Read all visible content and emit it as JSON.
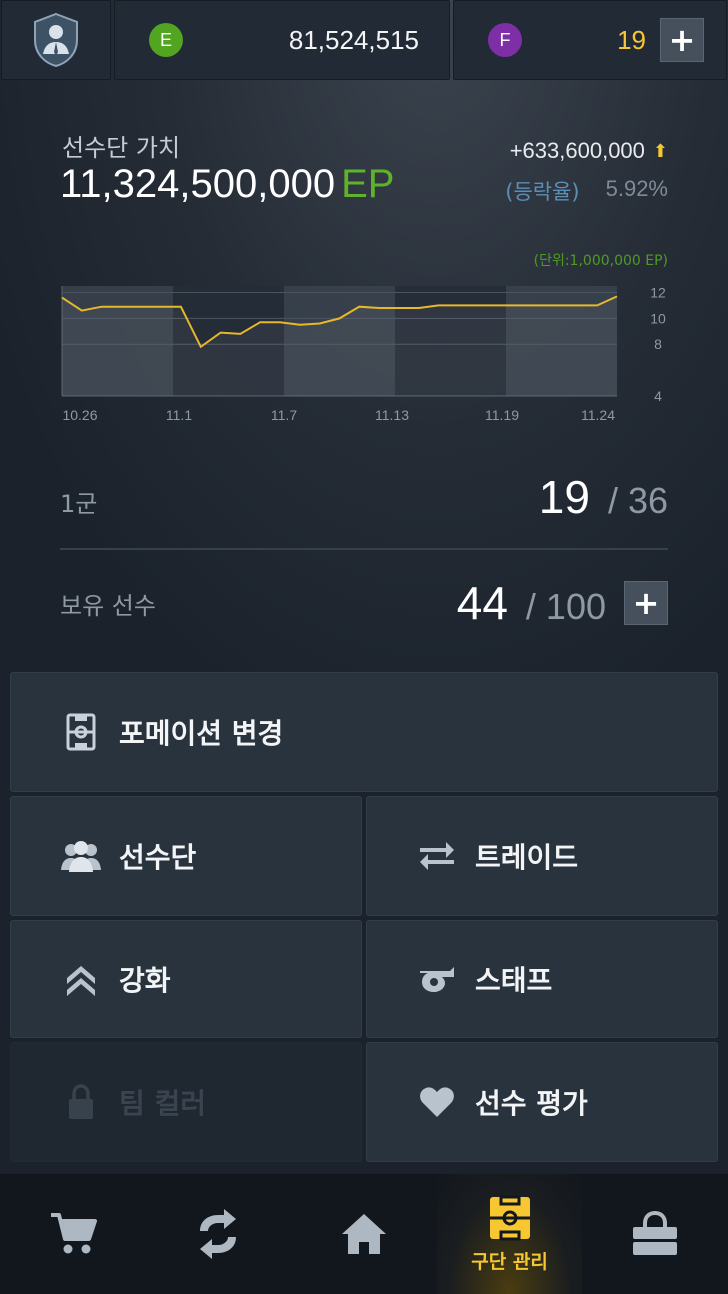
{
  "topbar": {
    "coin_e_letter": "E",
    "coin_e_value": "81,524,515",
    "coin_f_letter": "F",
    "coin_f_value": "19",
    "add_label": "+"
  },
  "squad_value": {
    "label": "선수단 가치",
    "amount": "11,324,500,000",
    "unit": "EP",
    "change": "+633,600,000",
    "rate_label": "(등락율)",
    "rate_value": "5.92%"
  },
  "chart_data": {
    "type": "line",
    "unit_note": "(단위:1,000,000 EP)",
    "x_ticks": [
      "10.26",
      "11.1",
      "11.7",
      "11.13",
      "11.19",
      "11.24"
    ],
    "y_ticks": [
      "12",
      "10",
      "8",
      "4"
    ],
    "ylim": [
      4,
      12.5
    ],
    "series": [
      {
        "values": [
          11.6,
          10.6,
          10.9,
          10.9,
          10.9,
          10.9,
          10.9,
          7.8,
          8.9,
          8.8,
          9.7,
          9.7,
          9.5,
          9.6,
          10.0,
          10.9,
          10.8,
          10.8,
          10.8,
          11.0,
          11.0,
          11.0,
          11.0,
          11.0,
          11.0,
          11.0,
          11.0,
          11.0,
          11.7
        ]
      }
    ],
    "colors": {
      "line": "#e8b82a",
      "band_dark": "#252d37",
      "band_light": "#3a434e"
    }
  },
  "squad": {
    "first_team_label": "1군",
    "first_team_count": "19",
    "first_team_max": "/ 36",
    "owned_label": "보유 선수",
    "owned_count": "44",
    "owned_max": "/ 100",
    "add_label": "+"
  },
  "menu": {
    "formation": "포메이션 변경",
    "squad": "선수단",
    "trade": "트레이드",
    "upgrade": "강화",
    "staff": "스태프",
    "team_color": "팀 컬러",
    "player_review": "선수 평가"
  },
  "nav": {
    "club_manage": "구단 관리"
  }
}
